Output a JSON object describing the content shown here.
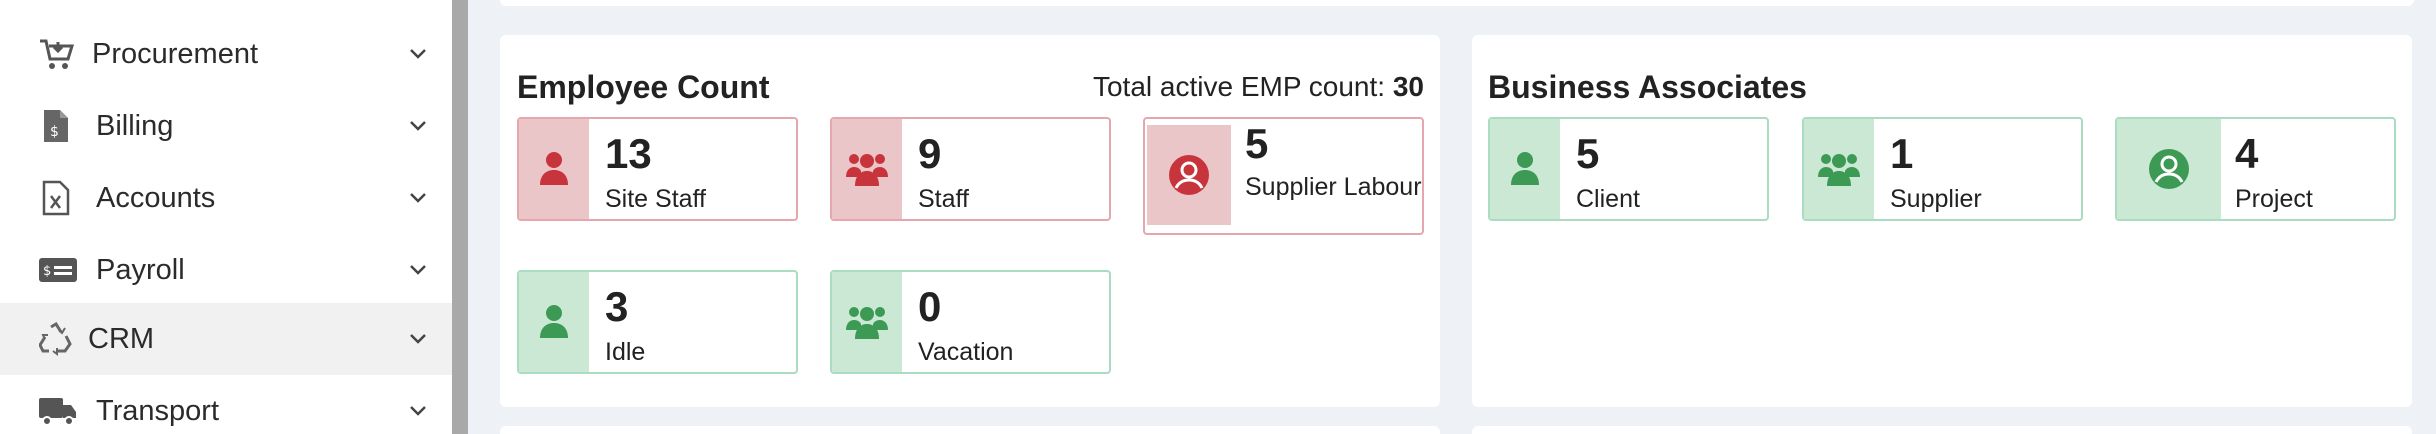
{
  "sidebar": {
    "items": [
      {
        "label": "Procurement",
        "icon": "cart-download-icon"
      },
      {
        "label": "Billing",
        "icon": "invoice-dollar-icon"
      },
      {
        "label": "Accounts",
        "icon": "excel-file-icon"
      },
      {
        "label": "Payroll",
        "icon": "money-bill-icon"
      },
      {
        "label": "CRM",
        "icon": "recycle-icon"
      },
      {
        "label": "Transport",
        "icon": "truck-icon"
      }
    ],
    "active_item": "CRM"
  },
  "employee_count": {
    "title": "Employee Count",
    "meta_label": "Total active EMP count:",
    "meta_value": "30",
    "cards": [
      {
        "value": "13",
        "label": "Site Staff",
        "color": "red",
        "icon": "user-icon"
      },
      {
        "value": "9",
        "label": "Staff",
        "color": "red",
        "icon": "users-group-icon"
      },
      {
        "value": "5",
        "label": "Supplier Labour",
        "color": "red",
        "icon": "user-circle-icon"
      },
      {
        "value": "3",
        "label": "Idle",
        "color": "green",
        "icon": "user-icon"
      },
      {
        "value": "0",
        "label": "Vacation",
        "color": "green",
        "icon": "users-group-icon"
      }
    ]
  },
  "business_associates": {
    "title": "Business Associates",
    "cards": [
      {
        "value": "5",
        "label": "Client",
        "color": "green",
        "icon": "user-icon"
      },
      {
        "value": "1",
        "label": "Supplier",
        "color": "green",
        "icon": "users-group-icon"
      },
      {
        "value": "4",
        "label": "Project",
        "color": "green",
        "icon": "user-circle-icon"
      }
    ]
  },
  "colors": {
    "red_icon": "#c8343c",
    "green_icon": "#3d9a55",
    "page_bg": "#eef1f6"
  }
}
